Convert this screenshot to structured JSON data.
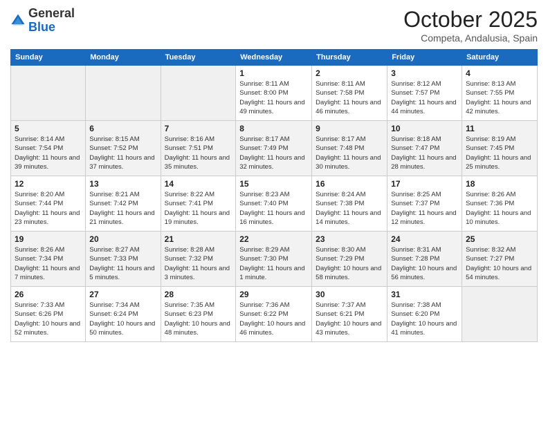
{
  "logo": {
    "general": "General",
    "blue": "Blue"
  },
  "header": {
    "month": "October 2025",
    "location": "Competa, Andalusia, Spain"
  },
  "weekdays": [
    "Sunday",
    "Monday",
    "Tuesday",
    "Wednesday",
    "Thursday",
    "Friday",
    "Saturday"
  ],
  "weeks": [
    [
      {
        "day": "",
        "info": ""
      },
      {
        "day": "",
        "info": ""
      },
      {
        "day": "",
        "info": ""
      },
      {
        "day": "1",
        "info": "Sunrise: 8:11 AM\nSunset: 8:00 PM\nDaylight: 11 hours and 49 minutes."
      },
      {
        "day": "2",
        "info": "Sunrise: 8:11 AM\nSunset: 7:58 PM\nDaylight: 11 hours and 46 minutes."
      },
      {
        "day": "3",
        "info": "Sunrise: 8:12 AM\nSunset: 7:57 PM\nDaylight: 11 hours and 44 minutes."
      },
      {
        "day": "4",
        "info": "Sunrise: 8:13 AM\nSunset: 7:55 PM\nDaylight: 11 hours and 42 minutes."
      }
    ],
    [
      {
        "day": "5",
        "info": "Sunrise: 8:14 AM\nSunset: 7:54 PM\nDaylight: 11 hours and 39 minutes."
      },
      {
        "day": "6",
        "info": "Sunrise: 8:15 AM\nSunset: 7:52 PM\nDaylight: 11 hours and 37 minutes."
      },
      {
        "day": "7",
        "info": "Sunrise: 8:16 AM\nSunset: 7:51 PM\nDaylight: 11 hours and 35 minutes."
      },
      {
        "day": "8",
        "info": "Sunrise: 8:17 AM\nSunset: 7:49 PM\nDaylight: 11 hours and 32 minutes."
      },
      {
        "day": "9",
        "info": "Sunrise: 8:17 AM\nSunset: 7:48 PM\nDaylight: 11 hours and 30 minutes."
      },
      {
        "day": "10",
        "info": "Sunrise: 8:18 AM\nSunset: 7:47 PM\nDaylight: 11 hours and 28 minutes."
      },
      {
        "day": "11",
        "info": "Sunrise: 8:19 AM\nSunset: 7:45 PM\nDaylight: 11 hours and 25 minutes."
      }
    ],
    [
      {
        "day": "12",
        "info": "Sunrise: 8:20 AM\nSunset: 7:44 PM\nDaylight: 11 hours and 23 minutes."
      },
      {
        "day": "13",
        "info": "Sunrise: 8:21 AM\nSunset: 7:42 PM\nDaylight: 11 hours and 21 minutes."
      },
      {
        "day": "14",
        "info": "Sunrise: 8:22 AM\nSunset: 7:41 PM\nDaylight: 11 hours and 19 minutes."
      },
      {
        "day": "15",
        "info": "Sunrise: 8:23 AM\nSunset: 7:40 PM\nDaylight: 11 hours and 16 minutes."
      },
      {
        "day": "16",
        "info": "Sunrise: 8:24 AM\nSunset: 7:38 PM\nDaylight: 11 hours and 14 minutes."
      },
      {
        "day": "17",
        "info": "Sunrise: 8:25 AM\nSunset: 7:37 PM\nDaylight: 11 hours and 12 minutes."
      },
      {
        "day": "18",
        "info": "Sunrise: 8:26 AM\nSunset: 7:36 PM\nDaylight: 11 hours and 10 minutes."
      }
    ],
    [
      {
        "day": "19",
        "info": "Sunrise: 8:26 AM\nSunset: 7:34 PM\nDaylight: 11 hours and 7 minutes."
      },
      {
        "day": "20",
        "info": "Sunrise: 8:27 AM\nSunset: 7:33 PM\nDaylight: 11 hours and 5 minutes."
      },
      {
        "day": "21",
        "info": "Sunrise: 8:28 AM\nSunset: 7:32 PM\nDaylight: 11 hours and 3 minutes."
      },
      {
        "day": "22",
        "info": "Sunrise: 8:29 AM\nSunset: 7:30 PM\nDaylight: 11 hours and 1 minute."
      },
      {
        "day": "23",
        "info": "Sunrise: 8:30 AM\nSunset: 7:29 PM\nDaylight: 10 hours and 58 minutes."
      },
      {
        "day": "24",
        "info": "Sunrise: 8:31 AM\nSunset: 7:28 PM\nDaylight: 10 hours and 56 minutes."
      },
      {
        "day": "25",
        "info": "Sunrise: 8:32 AM\nSunset: 7:27 PM\nDaylight: 10 hours and 54 minutes."
      }
    ],
    [
      {
        "day": "26",
        "info": "Sunrise: 7:33 AM\nSunset: 6:26 PM\nDaylight: 10 hours and 52 minutes."
      },
      {
        "day": "27",
        "info": "Sunrise: 7:34 AM\nSunset: 6:24 PM\nDaylight: 10 hours and 50 minutes."
      },
      {
        "day": "28",
        "info": "Sunrise: 7:35 AM\nSunset: 6:23 PM\nDaylight: 10 hours and 48 minutes."
      },
      {
        "day": "29",
        "info": "Sunrise: 7:36 AM\nSunset: 6:22 PM\nDaylight: 10 hours and 46 minutes."
      },
      {
        "day": "30",
        "info": "Sunrise: 7:37 AM\nSunset: 6:21 PM\nDaylight: 10 hours and 43 minutes."
      },
      {
        "day": "31",
        "info": "Sunrise: 7:38 AM\nSunset: 6:20 PM\nDaylight: 10 hours and 41 minutes."
      },
      {
        "day": "",
        "info": ""
      }
    ]
  ]
}
